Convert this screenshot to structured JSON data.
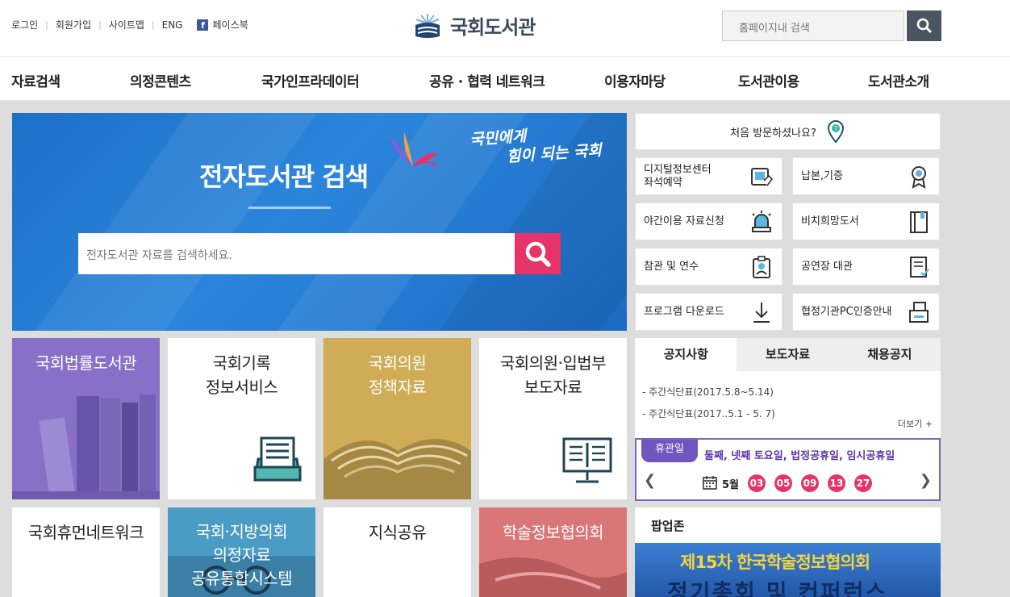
{
  "util_links": [
    "로그인",
    "회원가입",
    "사이트맵",
    "ENG",
    "페이스북"
  ],
  "logo": {
    "name": "국회도서관"
  },
  "search": {
    "placeholder": "홈페이지내 검색"
  },
  "gnb": [
    "자료검색",
    "의정콘텐츠",
    "국가인프라데이터",
    "공유 · 협력 네트워크",
    "이용자마당",
    "도서관이용",
    "도서관소개"
  ],
  "banner": {
    "title": "전자도서관 검색",
    "slogan_line1": "국민에게",
    "slogan_line2": "힘이 되는 국회",
    "search_placeholder": "전자도서관 자료를 검색하세요."
  },
  "quick": {
    "first_visit": "처음 방문하셨나요?",
    "items": [
      {
        "label": "디지털정보센터\n좌석예약",
        "icon": "tablet-touch-icon"
      },
      {
        "label": "납본,기증",
        "icon": "award-ribbon-icon"
      },
      {
        "label": "야간이용 자료신청",
        "icon": "alarm-light-icon"
      },
      {
        "label": "비치희망도서",
        "icon": "book-icon"
      },
      {
        "label": "참관 및 연수",
        "icon": "id-badge-icon"
      },
      {
        "label": "공연장 대관",
        "icon": "document-check-icon"
      },
      {
        "label": "프로그램 다운로드",
        "icon": "download-icon"
      },
      {
        "label": "협정기관PC인증안내",
        "icon": "printer-icon"
      }
    ]
  },
  "tiles": [
    {
      "title": "국회법률도서관"
    },
    {
      "title": "국회기록\n정보서비스"
    },
    {
      "title": "국회의원\n정책자료"
    },
    {
      "title": "국회의원·입법부\n보도자료"
    },
    {
      "title": "국회휴먼네트워크"
    },
    {
      "title": "국회·지방의회\n의정자료\n공유통합시스템"
    },
    {
      "title": "지식공유"
    },
    {
      "title": "학술정보협의회"
    }
  ],
  "notice": {
    "tabs": [
      "공지사항",
      "보도자료",
      "채용공지"
    ],
    "items": [
      "주간식단표(2017.5.8~5.14)",
      "주간식단표(2017..5.1 - 5. 7)"
    ],
    "more": "더보기 +"
  },
  "closed_days": {
    "badge": "휴관일",
    "desc": "둘째, 넷째 토요일, 법정공휴일, 임시공휴일",
    "month": "5월",
    "days": [
      "03",
      "05",
      "09",
      "13",
      "27"
    ]
  },
  "popup": {
    "title": "팝업존",
    "banner_line1": "제15차 한국학술정보협의회",
    "banner_line2": "정기총회 및 컨퍼런스"
  },
  "colors": {
    "accent_pink": "#e6346a",
    "banner_blue": "#2b85dc",
    "purple": "#6f56bf"
  }
}
